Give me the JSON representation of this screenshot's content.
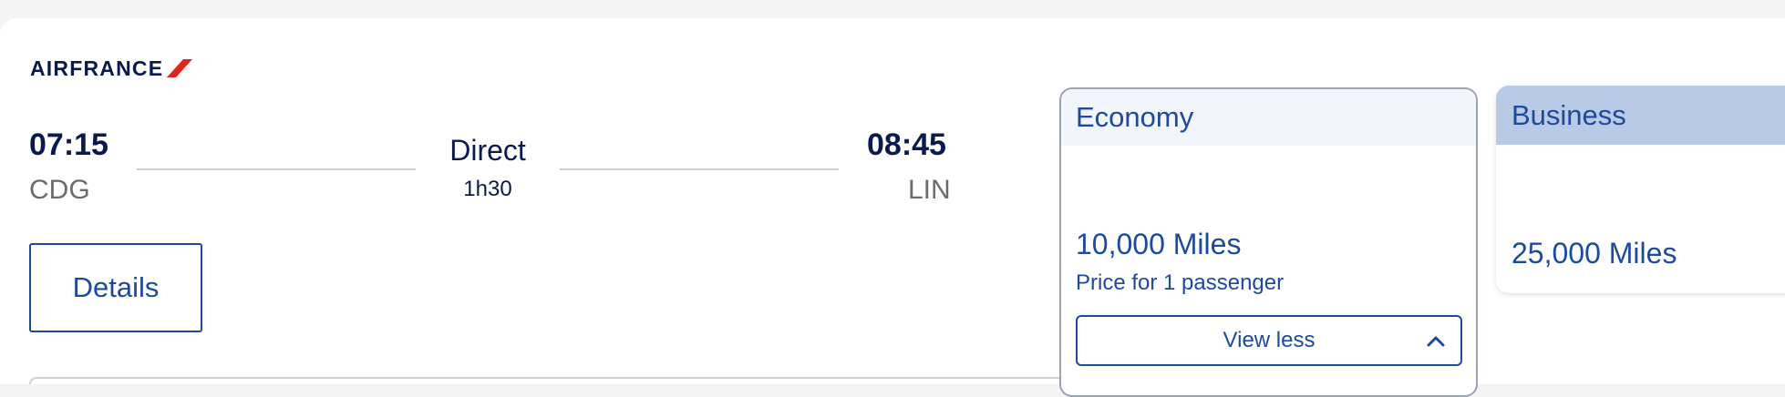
{
  "airline": {
    "name": "AIRFRANCE",
    "logo_icon": "airfrance-stripe-logo",
    "stripe_color": "#e1251b"
  },
  "flight": {
    "departure_time": "07:15",
    "departure_airport": "CDG",
    "arrival_time": "08:45",
    "arrival_airport": "LIN",
    "stops": "Direct",
    "duration": "1h30"
  },
  "details_button": {
    "label": "Details"
  },
  "fares": {
    "economy": {
      "cabin": "Economy",
      "miles": "10,000 Miles",
      "price_note": "Price for 1 passenger",
      "toggle_label": "View less",
      "toggle_icon": "chevron-up-icon"
    },
    "business": {
      "cabin": "Business",
      "miles": "25,000 Miles"
    }
  },
  "colors": {
    "brand_navy": "#0a1a4f",
    "accent_blue": "#1c4a9c",
    "business_header": "#b9cae6",
    "economy_header": "#f2f5fb"
  }
}
